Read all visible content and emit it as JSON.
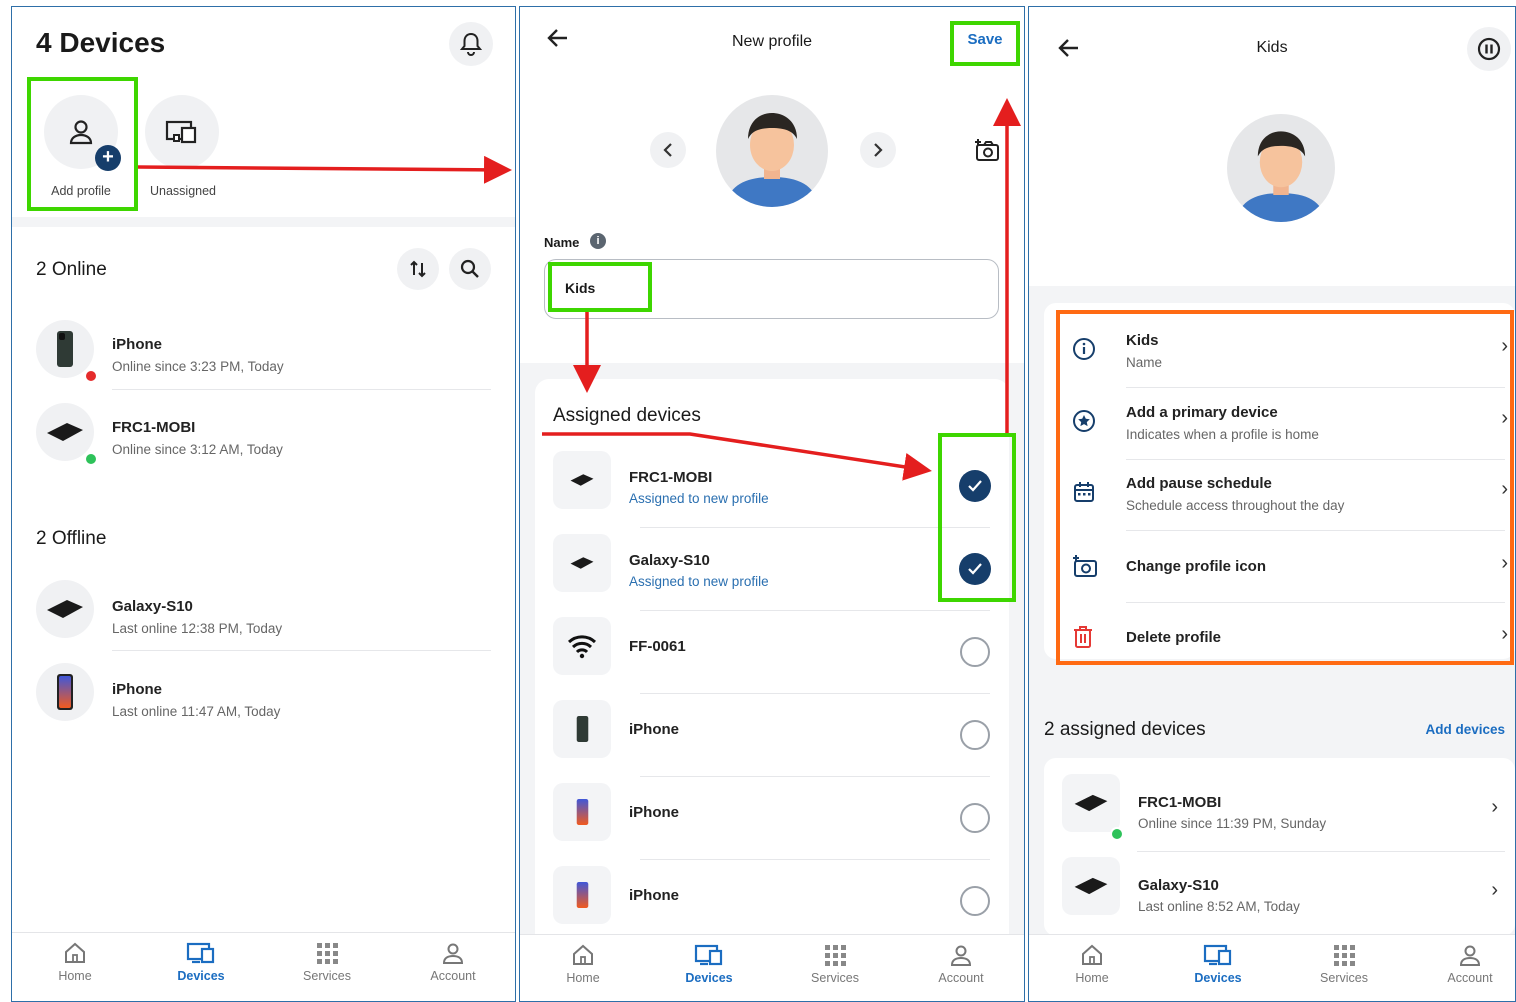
{
  "panel1": {
    "title": "4 Devices",
    "add_profile_label": "Add profile",
    "unassigned_label": "Unassigned",
    "online_header": "2 Online",
    "offline_header": "2 Offline",
    "online_devices": [
      {
        "name": "iPhone",
        "status": "Online since 3:23 PM, Today"
      },
      {
        "name": "FRC1-MOBI",
        "status": "Online since 3:12 AM, Today"
      }
    ],
    "offline_devices": [
      {
        "name": "Galaxy-S10",
        "status": "Last online 12:38 PM, Today"
      },
      {
        "name": "iPhone",
        "status": "Last online 11:47 AM, Today"
      }
    ]
  },
  "panel2": {
    "title": "New profile",
    "save_label": "Save",
    "name_label": "Name",
    "name_value": "Kids",
    "assigned_header": "Assigned devices",
    "devices": [
      {
        "name": "FRC1-MOBI",
        "sub": "Assigned to new profile",
        "checked": true
      },
      {
        "name": "Galaxy-S10",
        "sub": "Assigned to new profile",
        "checked": true
      },
      {
        "name": "FF-0061",
        "sub": "",
        "checked": false
      },
      {
        "name": "iPhone",
        "sub": "",
        "checked": false
      },
      {
        "name": "iPhone",
        "sub": "",
        "checked": false
      },
      {
        "name": "iPhone",
        "sub": "",
        "checked": false
      }
    ]
  },
  "panel3": {
    "title": "Kids",
    "settings": [
      {
        "title": "Kids",
        "sub": "Name"
      },
      {
        "title": "Add a primary device",
        "sub": "Indicates when a profile is home"
      },
      {
        "title": "Add pause schedule",
        "sub": "Schedule access throughout the day"
      },
      {
        "title": "Change profile icon",
        "sub": ""
      },
      {
        "title": "Delete profile",
        "sub": ""
      }
    ],
    "assigned_header": "2 assigned devices",
    "add_devices_label": "Add devices",
    "devices": [
      {
        "name": "FRC1-MOBI",
        "status": "Online since 11:39 PM, Sunday"
      },
      {
        "name": "Galaxy-S10",
        "status": "Last online 8:52 AM, Today"
      }
    ]
  },
  "nav": {
    "home": "Home",
    "devices": "Devices",
    "services": "Services",
    "account": "Account"
  },
  "colors": {
    "accent": "#1b6dc1",
    "highlight_green": "#3ed600",
    "highlight_orange": "#ff6a13",
    "arrow_red": "#e41e1e",
    "check_navy": "#163e6b"
  }
}
